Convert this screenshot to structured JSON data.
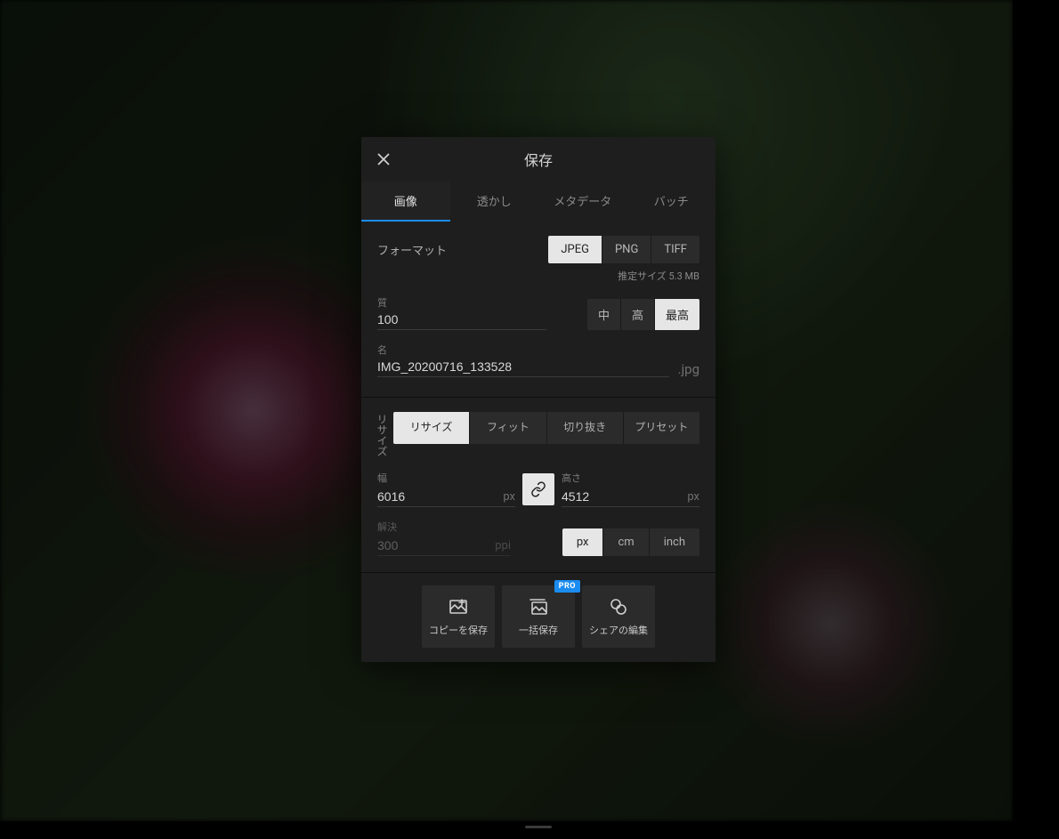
{
  "dialog": {
    "title": "保存",
    "tabs": [
      "画像",
      "透かし",
      "メタデータ",
      "バッチ"
    ],
    "active_tab_index": 0
  },
  "format": {
    "label": "フォーマット",
    "options": [
      "JPEG",
      "PNG",
      "TIFF"
    ],
    "selected_index": 0,
    "size_line": "推定サイズ 5.3 MB"
  },
  "quality": {
    "label": "質",
    "value": "100",
    "options": [
      "中",
      "高",
      "最高"
    ],
    "selected_index": 2
  },
  "name": {
    "label": "名",
    "value": "IMG_20200716_133528",
    "ext": ".jpg"
  },
  "resize": {
    "label": "リサイズ",
    "modes": [
      "リサイズ",
      "フィット",
      "切り抜き",
      "プリセット"
    ],
    "selected_mode_index": 0,
    "width_label": "幅",
    "width_value": "6016",
    "height_label": "高さ",
    "height_value": "4512",
    "dim_unit": "px",
    "resolution_label": "解決",
    "resolution_value": "300",
    "resolution_unit": "ppi",
    "units": [
      "px",
      "cm",
      "inch"
    ],
    "selected_unit_index": 0
  },
  "actions": {
    "save_copy": "コピーを保存",
    "batch_save": "一括保存",
    "share_edit": "シェアの編集",
    "pro_badge": "PRO"
  }
}
